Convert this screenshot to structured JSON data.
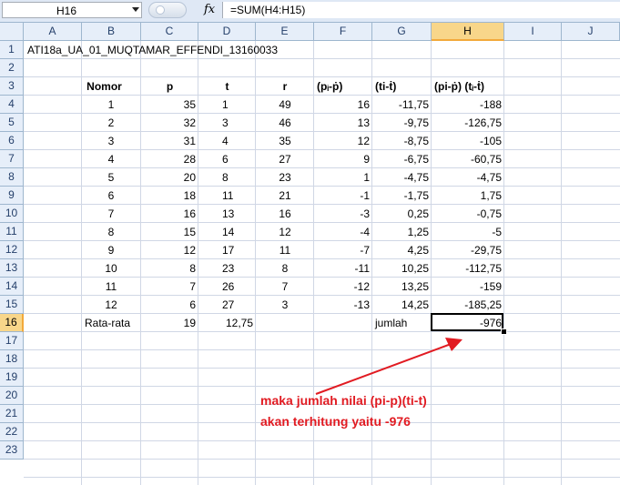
{
  "formula_bar": {
    "name_box": "H16",
    "fx_label": "fx",
    "formula": "=SUM(H4:H15)"
  },
  "columns": [
    "A",
    "B",
    "C",
    "D",
    "E",
    "F",
    "G",
    "H",
    "I",
    "J"
  ],
  "rows": [
    "1",
    "2",
    "3",
    "4",
    "5",
    "6",
    "7",
    "8",
    "9",
    "10",
    "11",
    "12",
    "13",
    "14",
    "15",
    "16",
    "17",
    "18",
    "19",
    "20",
    "21",
    "22",
    "23"
  ],
  "title": "ATI18a_UA_01_MUQTAMAR_EFFENDI_13160033",
  "headers": {
    "nomor": "Nomor",
    "p": "p",
    "t": "t",
    "r": "r",
    "f": "(pᵢ-ṗ)",
    "g": "(ti-ṫ)",
    "h": "(pi-ṗ) (tᵢ-ṫ)"
  },
  "table": [
    [
      "1",
      "35",
      "1",
      "49",
      "16",
      "-11,75",
      "-188"
    ],
    [
      "2",
      "32",
      "3",
      "46",
      "13",
      "-9,75",
      "-126,75"
    ],
    [
      "3",
      "31",
      "4",
      "35",
      "12",
      "-8,75",
      "-105"
    ],
    [
      "4",
      "28",
      "6",
      "27",
      "9",
      "-6,75",
      "-60,75"
    ],
    [
      "5",
      "20",
      "8",
      "23",
      "1",
      "-4,75",
      "-4,75"
    ],
    [
      "6",
      "18",
      "11",
      "21",
      "-1",
      "-1,75",
      "1,75"
    ],
    [
      "7",
      "16",
      "13",
      "16",
      "-3",
      "0,25",
      "-0,75"
    ],
    [
      "8",
      "15",
      "14",
      "12",
      "-4",
      "1,25",
      "-5"
    ],
    [
      "9",
      "12",
      "17",
      "11",
      "-7",
      "4,25",
      "-29,75"
    ],
    [
      "10",
      "8",
      "23",
      "8",
      "-11",
      "10,25",
      "-112,75"
    ],
    [
      "11",
      "7",
      "26",
      "7",
      "-12",
      "13,25",
      "-159"
    ],
    [
      "12",
      "6",
      "27",
      "3",
      "-13",
      "14,25",
      "-185,25"
    ]
  ],
  "summary": {
    "label": "Rata-rata",
    "p_mean": "19",
    "t_mean": "12,75",
    "jumlah_label": "jumlah",
    "jumlah_value": "-976"
  },
  "annotation": {
    "line1": "maka jumlah nilai (pi-p)(ti-t)",
    "line2": "akan terhitung yaitu -976",
    "color": "#e11b22"
  }
}
